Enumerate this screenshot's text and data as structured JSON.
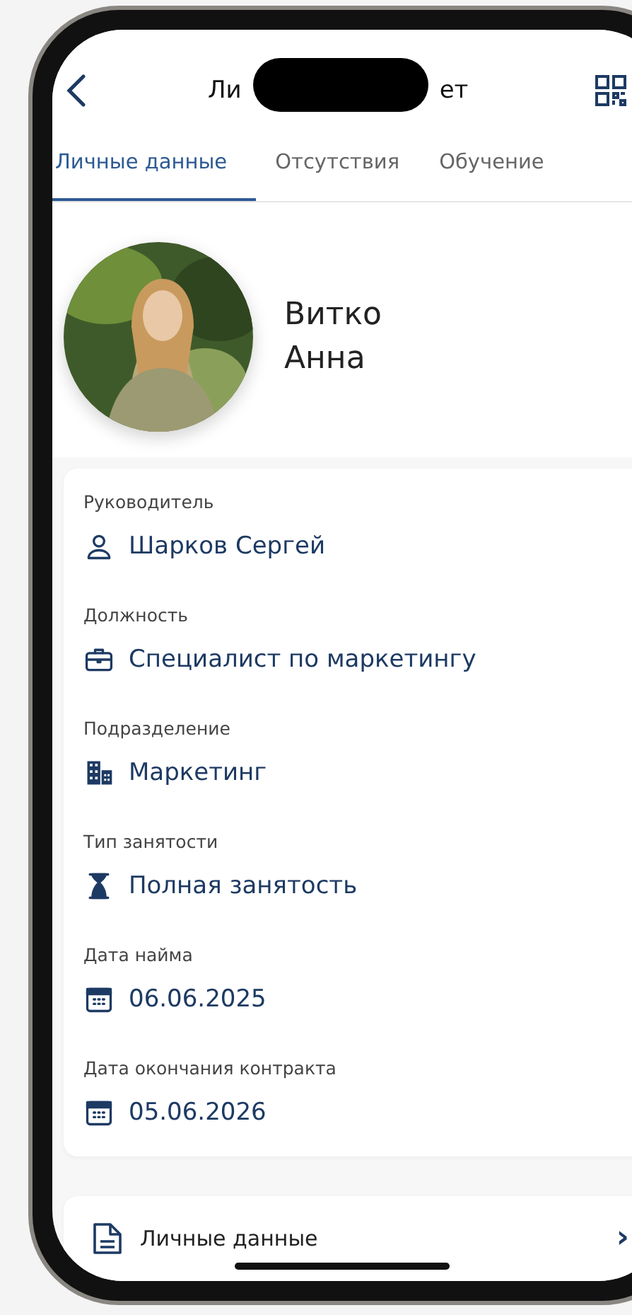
{
  "header": {
    "title_start": "Ли",
    "title_end": "ет"
  },
  "tabs": [
    {
      "label": "Личные данные",
      "selected": true
    },
    {
      "label": "Отсутствия",
      "selected": false
    },
    {
      "label": "Обучение",
      "selected": false
    }
  ],
  "profile": {
    "surname": "Витко",
    "name": "Анна"
  },
  "fields": [
    {
      "label": "Руководитель",
      "value": "Шарков Сергей",
      "kind": "person"
    },
    {
      "label": "Должность",
      "value": "Специалист по маркетингу",
      "kind": "briefcase"
    },
    {
      "label": "Подразделение",
      "value": "Маркетинг",
      "kind": "buildings"
    },
    {
      "label": "Тип занятости",
      "value": "Полная занятость",
      "kind": "hourglass"
    },
    {
      "label": "Дата найма",
      "value": "06.06.2025",
      "kind": "calendar"
    },
    {
      "label": "Дата окончания контракта",
      "value": "05.06.2026",
      "kind": "calendar"
    }
  ],
  "links": [
    {
      "label": "Личные данные",
      "chevron": "›"
    }
  ]
}
